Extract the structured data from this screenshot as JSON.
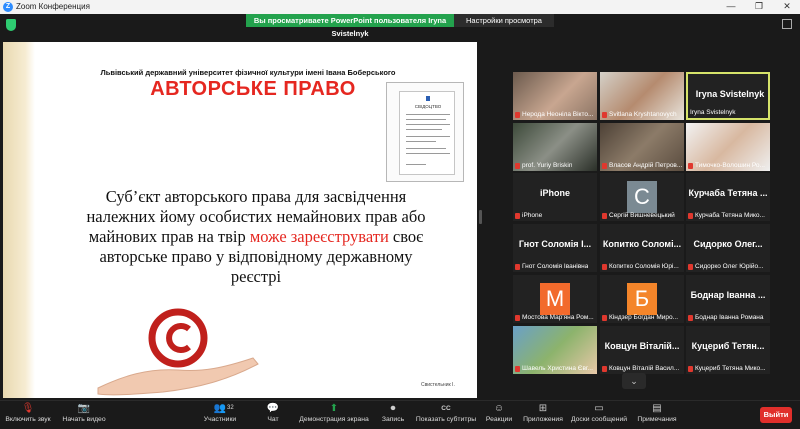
{
  "window": {
    "title": "Zoom Конференция",
    "logo_letter": "Z",
    "minimize": "—",
    "maximize": "❐",
    "close": "✕"
  },
  "banner": {
    "text": "Вы просматриваете PowerPoint пользователя Iryna Svistelnyk",
    "view_settings": "Настройки просмотра"
  },
  "slide": {
    "university": "Львівський державний університет фізичної культури імені Івана Боберського",
    "heading": "АВТОРСЬКЕ ПРАВО",
    "body_before": "Суб’єкт авторського права для засвідчення належних йому особистих немайнових прав або майнових прав на твір ",
    "body_highlight": "може зареєструвати",
    "body_after": " своє авторське право у відповідному державному реєстрі",
    "certificate_title": "СВІДОЦТВО",
    "footer": "Свистельник І."
  },
  "participants": [
    {
      "name": "Нерода Неоніла Вікто...",
      "type": "video"
    },
    {
      "name": "Svitlana Kryshtanovych",
      "type": "video"
    },
    {
      "name": "Iryna Svistelnyk",
      "big": "Iryna Svistelnyk",
      "type": "active"
    },
    {
      "name": "prof. Yuriy Briskin",
      "type": "video"
    },
    {
      "name": "Власов Андрій Петров...",
      "type": "video"
    },
    {
      "name": "Тимочко-Волошин Ро...",
      "type": "video"
    },
    {
      "name": "iPhone",
      "big": "iPhone",
      "type": "text"
    },
    {
      "name": "Сергій Вишневецький",
      "letter": "С",
      "color": "#7b8a93",
      "type": "letter"
    },
    {
      "name": "Курчаба Тетяна Мико...",
      "big": "Курчаба Тетяна ...",
      "type": "text"
    },
    {
      "name": "Гнот Соломія Іванівна",
      "big": "Гнот Соломія І...",
      "type": "text"
    },
    {
      "name": "Копитко Соломія Юрі...",
      "big": "Копитко Соломі...",
      "type": "text"
    },
    {
      "name": "Сидорко Олег Юрійо...",
      "big": "Сидорко Олег...",
      "type": "text"
    },
    {
      "name": "Мостова Мар'яна Ром...",
      "letter": "М",
      "color": "#f26a2c",
      "type": "letter"
    },
    {
      "name": "Кіндзер Богдан Миро...",
      "letter": "Б",
      "color": "#f4852a",
      "type": "letter"
    },
    {
      "name": "Боднар Іванна Романа",
      "big": "Боднар Іванна ...",
      "type": "text"
    },
    {
      "name": "Шавель Христина Євг...",
      "type": "video"
    },
    {
      "name": "Ковцун Віталій Васил...",
      "big": "Ковцун Віталій...",
      "type": "text"
    },
    {
      "name": "Куцериб Тетяна Мико...",
      "big": "Куцериб Тетян...",
      "type": "text"
    }
  ],
  "toolbar": {
    "audio": "Включить звук",
    "video": "Начать видео",
    "participants": "Участники",
    "participants_count": "32",
    "chat": "Чат",
    "share": "Демонстрация экрана",
    "record": "Запись",
    "captions": "Показать субтитры",
    "captions_badge": "CC",
    "reactions": "Реакции",
    "apps": "Приложения",
    "whiteboards": "Доски сообщений",
    "notes": "Примечания",
    "leave": "Выйти"
  },
  "colors": {
    "accent_red": "#e52720",
    "share_green": "#23a24d",
    "leave_red": "#e02f2b"
  }
}
